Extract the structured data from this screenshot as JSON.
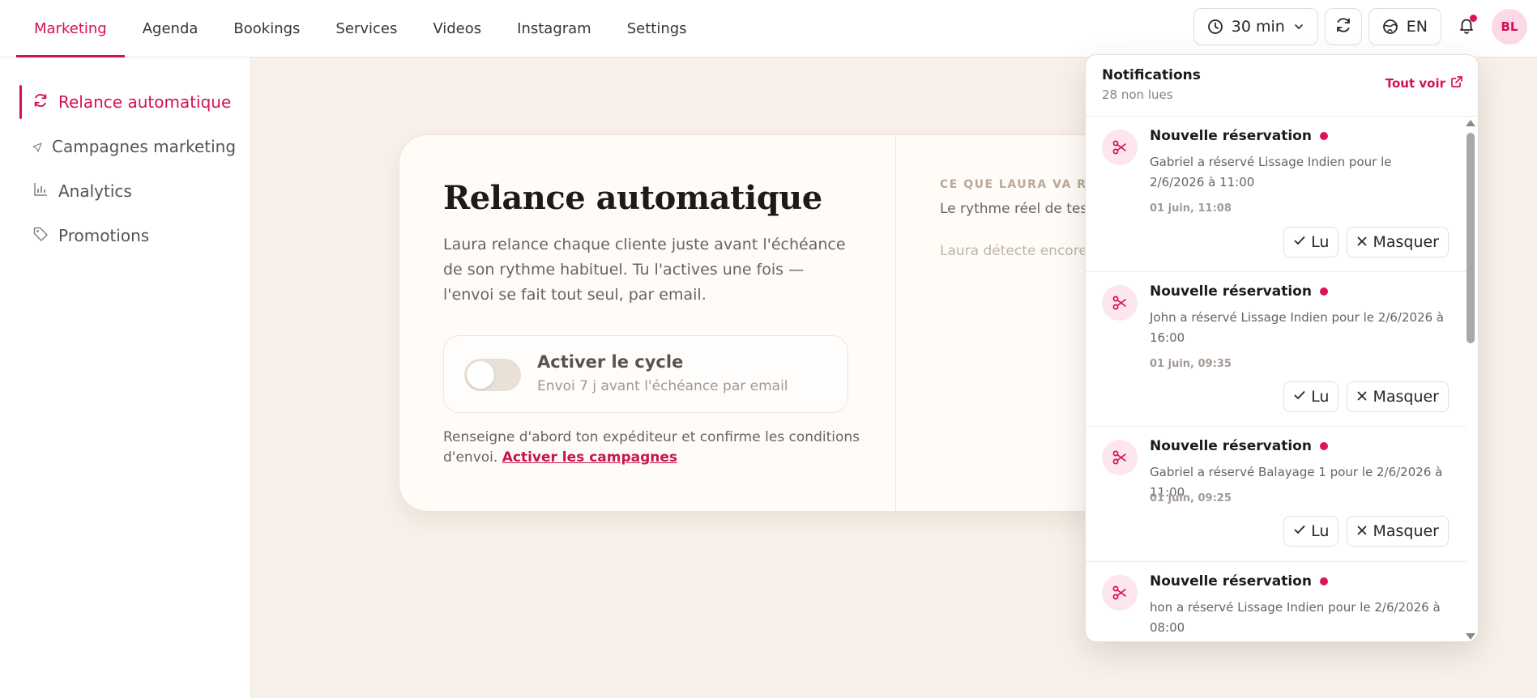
{
  "nav": {
    "items": [
      "Marketing",
      "Agenda",
      "Bookings",
      "Services",
      "Videos",
      "Instagram",
      "Settings"
    ],
    "active": "Marketing"
  },
  "toolbar": {
    "duration": "30 min",
    "language": "EN",
    "avatar_initials": "BL",
    "accent_color": "#d6105a"
  },
  "sidebar": {
    "items": [
      {
        "label": "Relance automatique",
        "icon": "refresh-icon",
        "active": true
      },
      {
        "label": "Campagnes marketing",
        "icon": "send-icon",
        "active": false
      },
      {
        "label": "Analytics",
        "icon": "bar-chart-icon",
        "active": false
      },
      {
        "label": "Promotions",
        "icon": "tag-icon",
        "active": false
      }
    ]
  },
  "main": {
    "title": "Relance automatique",
    "description": "Laura relance chaque cliente juste avant l'échéance de son rythme habituel. Tu l'actives une fois — l'envoi se fait tout seul, par email.",
    "toggle_title": "Activer le cycle",
    "toggle_subtitle": "Envoi 7 j avant l'échéance par email",
    "note_text": "Renseigne d'abord ton expéditeur et confirme les conditions d'envoi.",
    "note_link": "Activer les campagnes",
    "right_kicker": "CE QUE LAURA VA RE",
    "right_text": "Le rythme réel de tes c",
    "right_muted": "Laura détecte encore prestations apparaîtro"
  },
  "notifications": {
    "title": "Notifications",
    "unread": "28 non lues",
    "see_all": "Tout voir",
    "read_label": "Lu",
    "hide_label": "Masquer",
    "items": [
      {
        "title": "Nouvelle réservation",
        "body": "Gabriel a réservé Lissage Indien pour le 2/6/2026 à 11:00",
        "time": "01 juin, 11:08"
      },
      {
        "title": "Nouvelle réservation",
        "body": "John a réservé Lissage Indien pour le 2/6/2026 à 16:00",
        "time": "01 juin, 09:35"
      },
      {
        "title": "Nouvelle réservation",
        "body": "Gabriel a réservé Balayage 1 pour le 2/6/2026 à 11:00",
        "time": "01 juin, 09:25"
      },
      {
        "title": "Nouvelle réservation",
        "body": "hon a réservé Lissage Indien pour le 2/6/2026 à 08:00",
        "time": ""
      }
    ]
  }
}
